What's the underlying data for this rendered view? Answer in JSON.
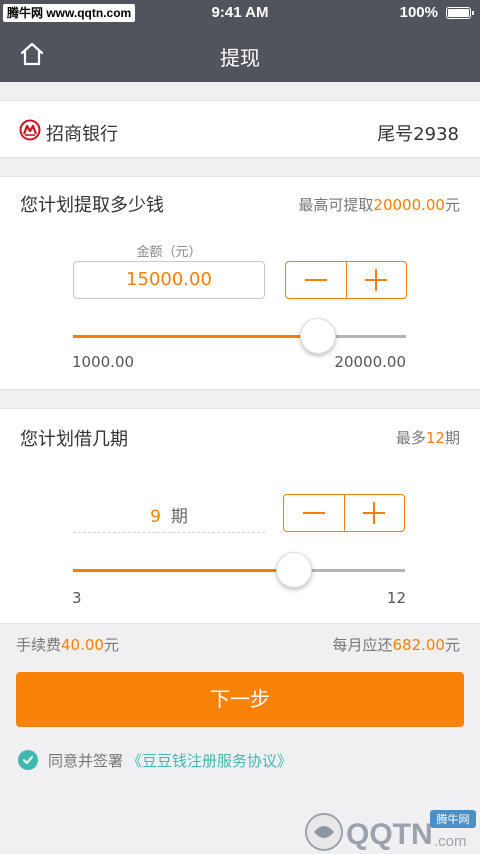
{
  "status_bar": {
    "watermark": "腾牛网 www.qqtn.com",
    "time": "9:41 AM",
    "battery": "100%"
  },
  "nav": {
    "title": "提现",
    "home_icon": "home-icon"
  },
  "bank": {
    "name": "招商银行",
    "tail": "尾号2938",
    "logo_icon": "cmb-bank-logo",
    "logo_color": "#c8141e"
  },
  "amount": {
    "title": "您计划提取多少钱",
    "hint_prefix": "最高可提取",
    "hint_value": "20000.00",
    "hint_suffix": "元",
    "label": "金额（元）",
    "value": "15000.00",
    "min": "1000.00",
    "max": "20000.00",
    "slider_min": 1000,
    "slider_max": 20000,
    "slider_value": 15000
  },
  "period": {
    "title": "您计划借几期",
    "hint_prefix": "最多",
    "hint_value": "12",
    "hint_suffix": "期",
    "value": "9",
    "unit": "期",
    "min": "3",
    "max": "12",
    "slider_min": 3,
    "slider_max": 12,
    "slider_value": 9
  },
  "fees": {
    "fee_prefix": "手续费",
    "fee_value": "40.00",
    "fee_suffix": "元",
    "monthly_prefix": "每月应还",
    "monthly_value": "682.00",
    "monthly_suffix": "元"
  },
  "next_button": "下一步",
  "agreement": {
    "text": "同意并签署",
    "link": "《豆豆钱注册服务协议》",
    "checked": true
  },
  "corner_watermark": {
    "brand": "QQTN",
    "domain": ".com",
    "tag": "腾牛网"
  },
  "colors": {
    "accent": "#f57f06",
    "button": "#f98208",
    "header": "#51545d",
    "check": "#3fb8af"
  }
}
